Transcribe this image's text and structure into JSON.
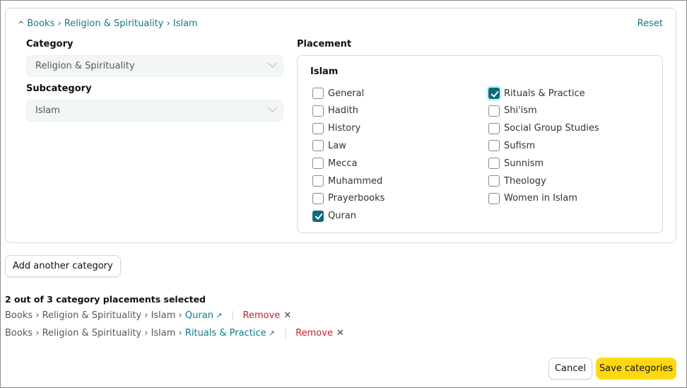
{
  "header": {
    "breadcrumb": [
      "Books",
      "Religion & Spirituality",
      "Islam"
    ],
    "separator": "›",
    "reset_label": "Reset"
  },
  "category": {
    "label": "Category",
    "value": "Religion & Spirituality"
  },
  "subcategory": {
    "label": "Subcategory",
    "value": "Islam"
  },
  "placement": {
    "label": "Placement",
    "group_title": "Islam",
    "left_column": [
      {
        "label": "General",
        "checked": false
      },
      {
        "label": "Hadith",
        "checked": false
      },
      {
        "label": "History",
        "checked": false
      },
      {
        "label": "Law",
        "checked": false
      },
      {
        "label": "Mecca",
        "checked": false
      },
      {
        "label": "Muhammed",
        "checked": false
      },
      {
        "label": "Prayerbooks",
        "checked": false
      },
      {
        "label": "Quran",
        "checked": true
      }
    ],
    "right_column": [
      {
        "label": "Rituals & Practice",
        "checked": true
      },
      {
        "label": "Shi'ism",
        "checked": false
      },
      {
        "label": "Social Group Studies",
        "checked": false
      },
      {
        "label": "Sufism",
        "checked": false
      },
      {
        "label": "Sunnism",
        "checked": false
      },
      {
        "label": "Theology",
        "checked": false
      },
      {
        "label": "Women in Islam",
        "checked": false
      }
    ]
  },
  "add_category_label": "Add another category",
  "summary": {
    "text": "2 out of 3 category placements selected",
    "selected": [
      {
        "path": "Books › Religion & Spirituality › Islam ›",
        "leaf": "Quran",
        "ext_icon": "↗",
        "remove_label": "Remove"
      },
      {
        "path": "Books › Religion & Spirituality › Islam ›",
        "leaf": "Rituals & Practice",
        "ext_icon": "↗",
        "remove_label": "Remove"
      }
    ]
  },
  "footer": {
    "cancel_label": "Cancel",
    "save_label": "Save categories"
  },
  "colors": {
    "link": "#0f7b8a",
    "checkbox_checked": "#0f6a7b",
    "remove": "#c7202d",
    "primary_button": "#ffd814"
  }
}
